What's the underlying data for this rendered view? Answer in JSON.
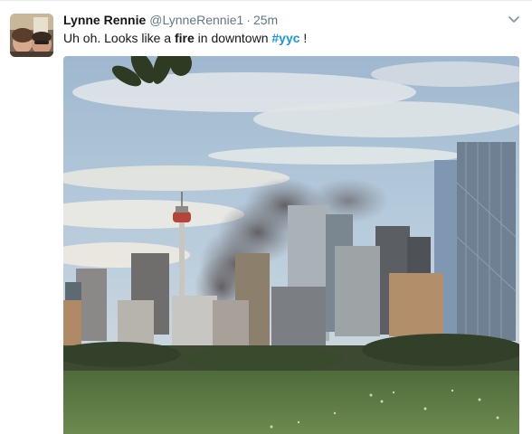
{
  "tweet": {
    "author_name": "Lynne Rennie",
    "author_handle": "@LynneRennie1",
    "separator": "·",
    "timestamp": "25m",
    "text_part1": "Uh oh. Looks like a ",
    "text_bold": "fire",
    "text_part2": " in downtown ",
    "hashtag": "#yyc",
    "text_part3": " !",
    "caret_icon": "chevron-down-icon",
    "avatar_icon": "avatar-photo",
    "media_description": "photo"
  },
  "colors": {
    "name": "#14171a",
    "muted": "#657786",
    "link": "#1b95e0",
    "border": "#e6ecf0"
  }
}
